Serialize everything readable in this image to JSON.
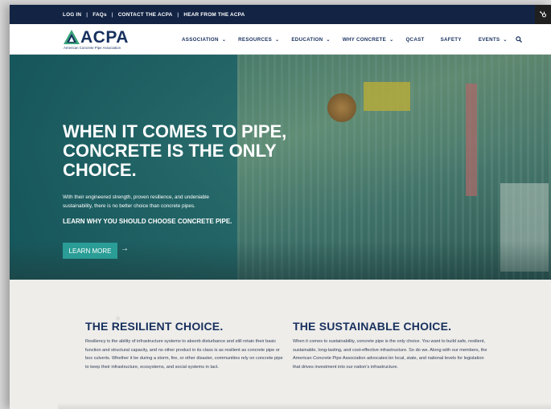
{
  "utility_bar": {
    "links": [
      "LOG IN",
      "FAQs",
      "CONTACT THE ACPA",
      "HEAR FROM THE ACPA"
    ],
    "separator": "|"
  },
  "header": {
    "logo_text": "ACPA",
    "logo_subtitle": "American Concrete Pipe Association",
    "nav": [
      {
        "label": "ASSOCIATION",
        "dropdown": true
      },
      {
        "label": "RESOURCES",
        "dropdown": true
      },
      {
        "label": "EDUCATION",
        "dropdown": true
      },
      {
        "label": "WHY CONCRETE",
        "dropdown": true
      },
      {
        "label": "QCAST",
        "dropdown": false
      },
      {
        "label": "SAFETY",
        "dropdown": false
      },
      {
        "label": "EVENTS",
        "dropdown": true
      }
    ],
    "search_icon": "search-icon",
    "chevron_glyph": "⌄"
  },
  "hero": {
    "title_lines": [
      "WHEN IT COMES TO PIPE,",
      "CONCRETE IS THE ONLY",
      "CHOICE."
    ],
    "text": "With their engineered strength, proven resilience, and undeniable sustainability, there is no better choice than concrete pipes.",
    "cta_text": "LEARN WHY YOU SHOULD CHOOSE CONCRETE PIPE.",
    "button_label": "LEARN MORE",
    "arrow": "→"
  },
  "sections": [
    {
      "title": "THE RESILIENT CHOICE.",
      "body": "Resiliency is the ability of infrastructure systems to absorb disturbance and still retain their basic function and structural capacity, and no other product in its class is as resilient as concrete pipe or box culverts. Whether it be during a storm, fire, or other disaster, communities rely on concrete pipe to keep their infrastructure, ecosystems, and social systems in tact."
    },
    {
      "title": "THE SUSTAINABLE CHOICE.",
      "body": "When it comes to sustainability, concrete pipe is the only choice. You want to build safe, resilient, sustainable, long-lasting, and cost-effective infrastructure. So do we. Along with our members, the American Concrete Pipe Association advocates on local, state, and national levels for legislation that drives investment into our nation's infrastructure."
    }
  ],
  "colors": {
    "navy": "#122344",
    "brand_blue": "#17305e",
    "teal_button": "#2a9d96",
    "logo_green": "#3aa37a"
  }
}
